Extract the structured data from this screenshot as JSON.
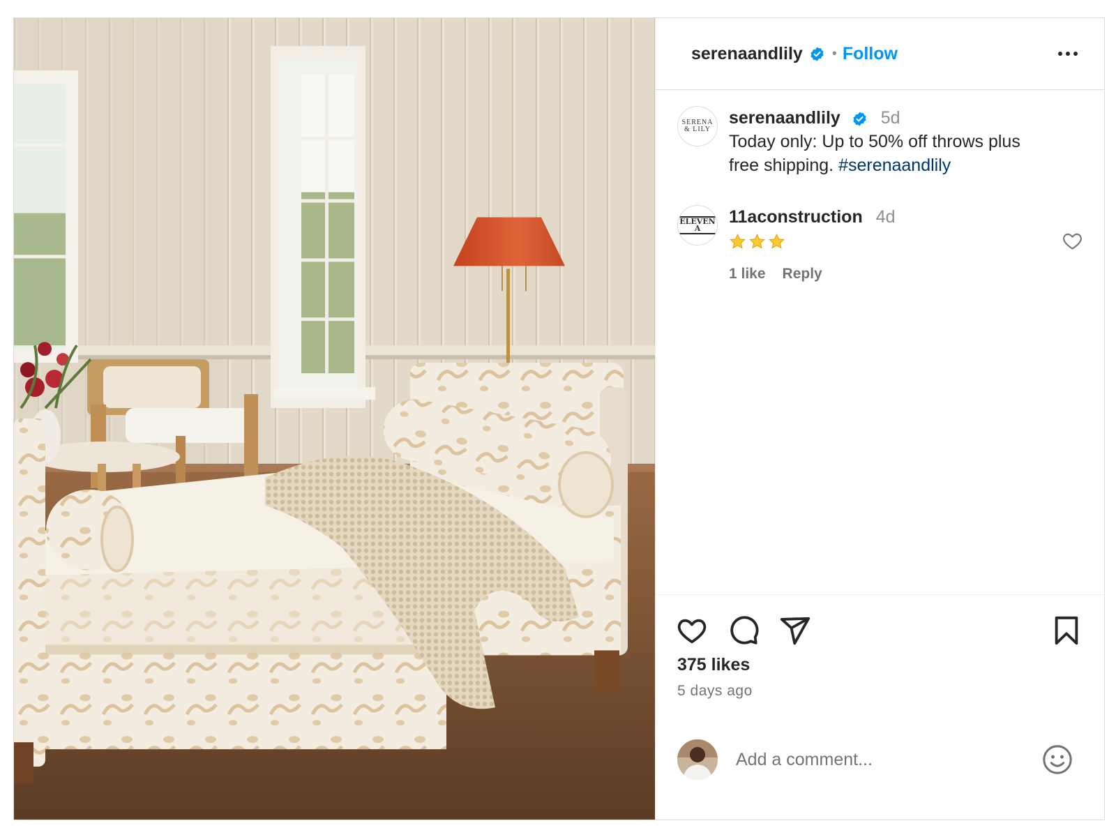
{
  "header": {
    "username": "serenaandlily",
    "separator": "•",
    "follow_label": "Follow"
  },
  "caption": {
    "username": "serenaandlily",
    "time": "5d",
    "text_line1": "Today only: Up to 50% off throws plus",
    "text_line2": "free shipping.",
    "hashtag": "#serenaandlily",
    "avatar_logo_line1": "SERENA",
    "avatar_logo_line2": "& LILY"
  },
  "comment": {
    "username": "11aconstruction",
    "time": "4d",
    "stars": 3,
    "likes_label": "1 like",
    "reply_label": "Reply",
    "avatar_logo": "ELEVEN A"
  },
  "post": {
    "likes": "375 likes",
    "posted": "5 days ago"
  },
  "composer": {
    "placeholder": "Add a comment..."
  },
  "colors": {
    "accent": "#0095f6",
    "hashtag": "#00376b",
    "text": "#262626",
    "muted": "#737373"
  },
  "icons": [
    "verified-badge-icon",
    "more-options-icon",
    "heart-icon",
    "comment-icon",
    "share-icon",
    "bookmark-icon",
    "emoji-icon",
    "star-icon"
  ]
}
